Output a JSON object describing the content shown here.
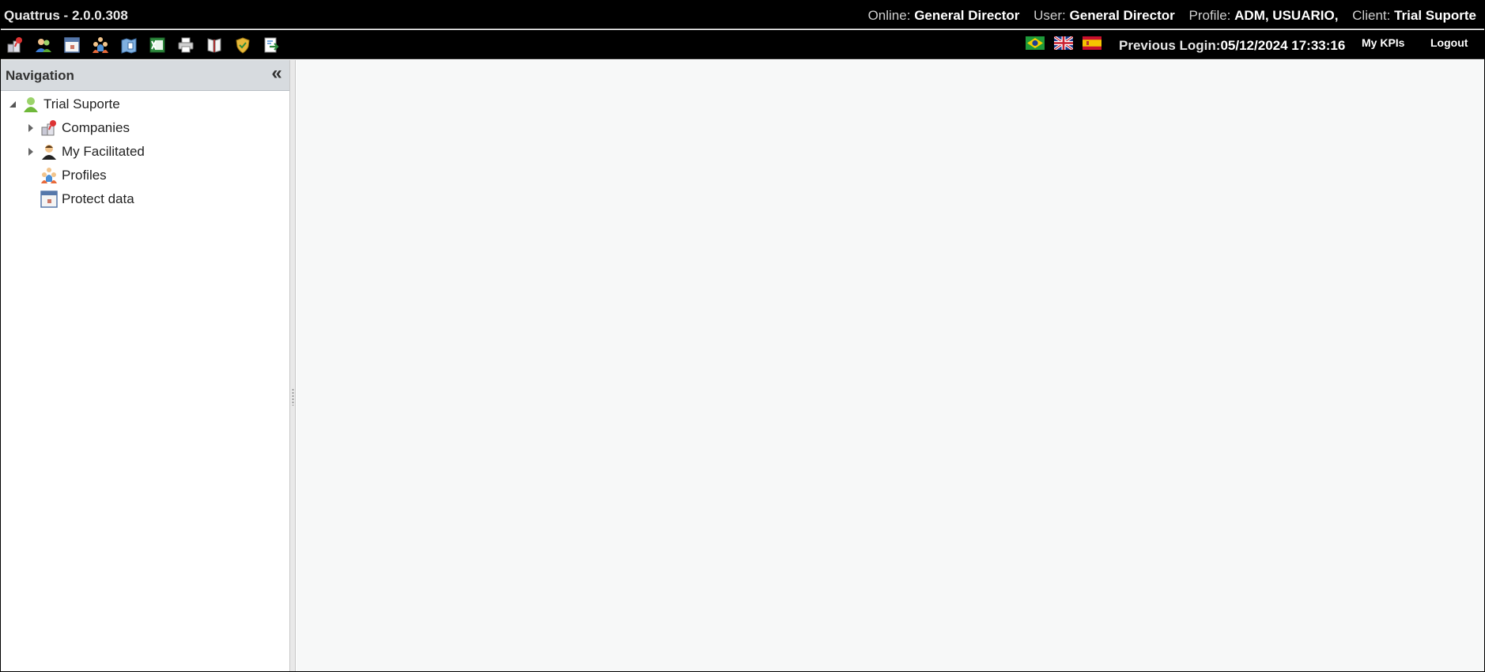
{
  "app": {
    "title": "Quattrus - 2.0.0.308"
  },
  "session": {
    "online_label": "Online:",
    "online_value": "General Director",
    "user_label": "User:",
    "user_value": "General Director",
    "profile_label": "Profile:",
    "profile_value": "ADM, USUARIO,",
    "client_label": "Client:",
    "client_value": "Trial Suporte"
  },
  "toolbar": {
    "tools": [
      {
        "icon": "companies-icon"
      },
      {
        "icon": "users-icon"
      },
      {
        "icon": "calendar-icon"
      },
      {
        "icon": "profiles-icon"
      },
      {
        "icon": "map-icon"
      },
      {
        "icon": "excel-icon"
      },
      {
        "icon": "printer-icon"
      },
      {
        "icon": "book-icon"
      },
      {
        "icon": "shield-icon"
      },
      {
        "icon": "export-icon"
      }
    ],
    "flags": [
      {
        "icon": "brazil-flag-icon"
      },
      {
        "icon": "uk-flag-icon"
      },
      {
        "icon": "spain-flag-icon"
      }
    ],
    "previous_login_label": "Previous Login:",
    "previous_login_value": "05/12/2024 17:33:16",
    "my_kpis": "My KPIs",
    "logout": "Logout"
  },
  "navigation": {
    "title": "Navigation",
    "collapse_icon": "double-chevron-left-icon",
    "root": {
      "label": "Trial Suporte",
      "icon": "client-icon",
      "expanded": true
    },
    "items": [
      {
        "label": "Companies",
        "icon": "companies-icon",
        "expandable": true
      },
      {
        "label": "My Facilitated",
        "icon": "user-icon",
        "expandable": true
      },
      {
        "label": "Profiles",
        "icon": "profiles-icon",
        "expandable": false
      },
      {
        "label": "Protect data",
        "icon": "calendar-icon",
        "expandable": false
      }
    ]
  },
  "colors": {
    "header_bg": "#000000",
    "nav_header_bg": "#d7dbdf",
    "content_bg": "#f7f8f8"
  }
}
